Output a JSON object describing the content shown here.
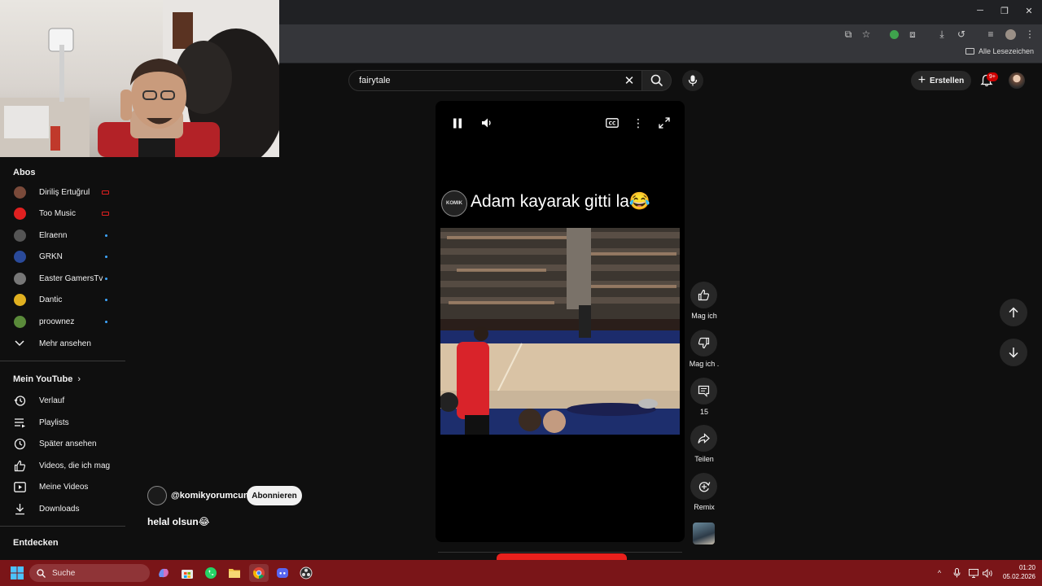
{
  "browser": {
    "bookmarks_all_label": "Alle Lesezeichen",
    "window_controls": [
      "minimize",
      "maximize",
      "close"
    ]
  },
  "header": {
    "search_value": "fairytale",
    "create_label": "Erstellen",
    "notifications_badge": "9+"
  },
  "sidebar": {
    "subscriptions_heading": "Abos",
    "channels": [
      {
        "name": "Diriliş Ertuğrul",
        "status": "live",
        "color": "#7a4a3a"
      },
      {
        "name": "Too Music",
        "status": "live",
        "color": "#e02020"
      },
      {
        "name": "Elraenn",
        "status": "new",
        "color": "#555555"
      },
      {
        "name": "GRKN",
        "status": "new",
        "color": "#2a4a9a"
      },
      {
        "name": "Easter GamersTv",
        "status": "new",
        "color": "#777777"
      },
      {
        "name": "Dantic",
        "status": "new",
        "color": "#e0b020"
      },
      {
        "name": "proownez",
        "status": "new",
        "color": "#5a8a3a"
      }
    ],
    "more_label": "Mehr ansehen",
    "my_youtube_heading": "Mein YouTube",
    "my_youtube_items": [
      {
        "label": "Verlauf",
        "icon": "history-icon"
      },
      {
        "label": "Playlists",
        "icon": "playlists-icon"
      },
      {
        "label": "Später ansehen",
        "icon": "watch-later-icon"
      },
      {
        "label": "Videos, die ich mag",
        "icon": "liked-videos-icon"
      },
      {
        "label": "Meine Videos",
        "icon": "my-videos-icon"
      },
      {
        "label": "Downloads",
        "icon": "downloads-icon"
      }
    ],
    "explore_heading": "Entdecken"
  },
  "short": {
    "caption": "Adam kayarak gitti la😂",
    "logo_text": "KOMIK",
    "channel_handle": "@komikyorumcun",
    "subscribe_label": "Abonnieren",
    "title": "helal olsun😂",
    "actions": {
      "like_label": "Mag ich",
      "dislike_label": "Mag ich .",
      "comments_count": "15",
      "share_label": "Teilen",
      "remix_label": "Remix"
    }
  },
  "taskbar": {
    "search_placeholder": "Suche",
    "time": "01:20",
    "date": "05.02.2026"
  }
}
